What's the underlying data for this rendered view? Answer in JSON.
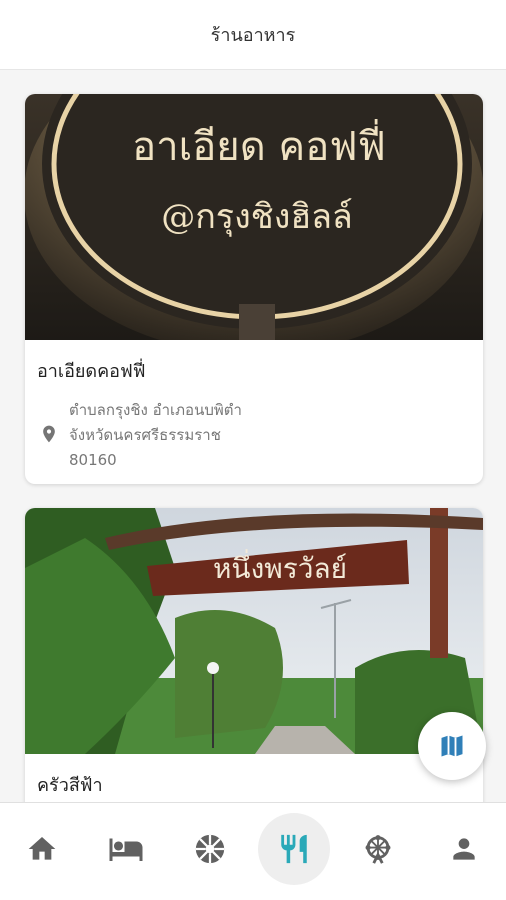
{
  "header": {
    "title": "ร้านอาหาร"
  },
  "colors": {
    "icon_gray": "#616161",
    "active_teal": "#2aa9b8",
    "map_blue": "#2f7fb8"
  },
  "cards": [
    {
      "name": "อาเอียดคอฟฟี่",
      "sign_line1": "อาเอียด คอฟฟี่",
      "sign_line2": "@กรุงชิงฮิลล์",
      "address": [
        "ตำบลกรุงชิง อำเภอนบพิตำ",
        "จังหวัดนครศรีธรรมราช",
        "80160"
      ],
      "pin_icon": "location-pin-icon"
    },
    {
      "name": "ครัวสีฟ้า",
      "sign_text": "หนึ่งพรวัลย์"
    }
  ],
  "map_button": {
    "icon": "map-icon"
  },
  "bottom_nav": [
    {
      "id": "home",
      "icon": "home-icon",
      "active": false
    },
    {
      "id": "hotel",
      "icon": "bed-icon",
      "active": false
    },
    {
      "id": "attractions",
      "icon": "camera-aperture-icon",
      "active": false
    },
    {
      "id": "restaurants",
      "icon": "fork-knife-icon",
      "active": true
    },
    {
      "id": "activities",
      "icon": "ferris-wheel-icon",
      "active": false
    },
    {
      "id": "profile",
      "icon": "person-icon",
      "active": false
    }
  ]
}
